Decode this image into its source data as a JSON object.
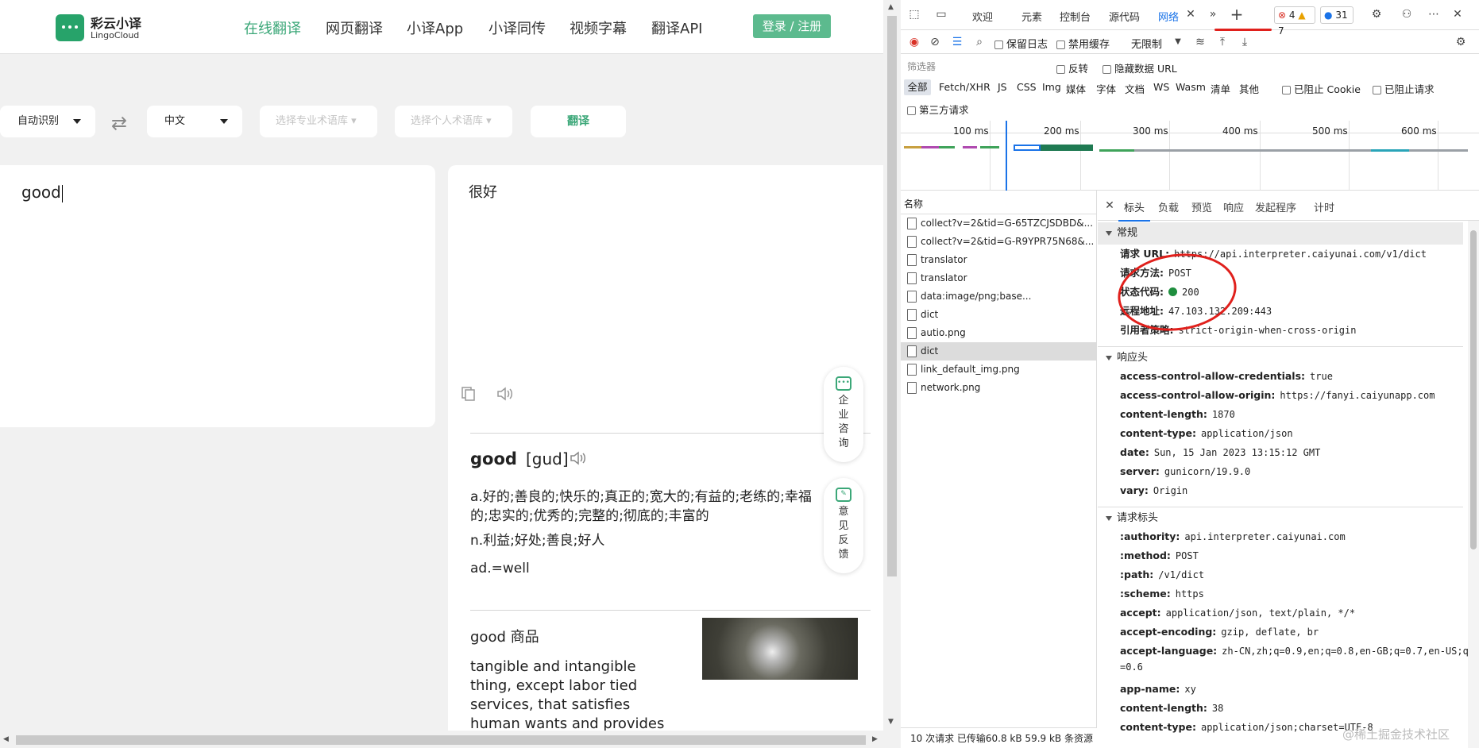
{
  "app": {
    "logo_name": "彩云小译",
    "logo_sub": "LingoCloud",
    "nav": [
      "在线翻译",
      "网页翻译",
      "小译App",
      "小译同传",
      "视频字幕",
      "翻译API"
    ],
    "login": "登录 / 注册",
    "source_lang": "自动识别",
    "target_lang": "中文",
    "term_lib_placeholder": "选择专业术语库 ▾",
    "personal_lib_placeholder": "选择个人术语库 ▾",
    "translate_button": "翻译",
    "swap_icon": "swap-arrows-icon",
    "source_text": "good",
    "result_text": "很好",
    "dict": {
      "word": "good",
      "phonetic": "[gud]",
      "defs": [
        "a.好的;善良的;快乐的;真正的;宽大的;有益的;老练的;幸福的;忠实的;优秀的;完整的;彻底的;丰富的",
        "n.利益;好处;善良;好人",
        "ad.=well"
      ]
    },
    "phrase": {
      "title": "good 商品",
      "desc": "tangible and intangible thing, except labor tied services, that satisfies human wants and provides utility"
    },
    "side_consult": "企业咨询",
    "side_feedback": "意见反馈"
  },
  "devtools": {
    "tabs": [
      "欢迎",
      "元素",
      "控制台",
      "源代码",
      "网络"
    ],
    "errors": "4",
    "warnings": "7",
    "messages": "31",
    "toolbar": {
      "preserve_log": "保留日志",
      "disable_cache": "禁用缓存",
      "throttle": "无限制"
    },
    "filter_placeholder": "筛选器",
    "invert": "反转",
    "hide_data_urls": "隐藏数据 URL",
    "filter_types": [
      "全部",
      "Fetch/XHR",
      "JS",
      "CSS",
      "Img",
      "媒体",
      "字体",
      "文档",
      "WS",
      "Wasm",
      "清单",
      "其他"
    ],
    "blocked_cookies": "已阻止 Cookie",
    "blocked_requests": "已阻止请求",
    "third_party": "第三方请求",
    "timeline_labels": [
      "100 ms",
      "200 ms",
      "300 ms",
      "400 ms",
      "500 ms",
      "600 ms"
    ],
    "name_header": "名称",
    "requests": [
      "collect?v=2&tid=G-65TZCJSDBD&...",
      "collect?v=2&tid=G-R9YPR75N68&...",
      "translator",
      "translator",
      "data:image/png;base...",
      "dict",
      "autio.png",
      "dict",
      "link_default_img.png",
      "network.png"
    ],
    "detail_tabs": [
      "标头",
      "负载",
      "预览",
      "响应",
      "发起程序",
      "计时"
    ],
    "general_title": "常规",
    "general": [
      {
        "k": "请求 URL:",
        "v": "https://api.interpreter.caiyunai.com/v1/dict"
      },
      {
        "k": "请求方法:",
        "v": "POST"
      },
      {
        "k": "状态代码:",
        "v": "200"
      },
      {
        "k": "远程地址:",
        "v": "47.103.132.209:443"
      },
      {
        "k": "引用者策略:",
        "v": "strict-origin-when-cross-origin"
      }
    ],
    "response_title": "响应头",
    "response_headers": [
      {
        "k": "access-control-allow-credentials:",
        "v": "true"
      },
      {
        "k": "access-control-allow-origin:",
        "v": "https://fanyi.caiyunapp.com"
      },
      {
        "k": "content-length:",
        "v": "1870"
      },
      {
        "k": "content-type:",
        "v": "application/json"
      },
      {
        "k": "date:",
        "v": "Sun, 15 Jan 2023 13:15:12 GMT"
      },
      {
        "k": "server:",
        "v": "gunicorn/19.9.0"
      },
      {
        "k": "vary:",
        "v": "Origin"
      }
    ],
    "request_title": "请求标头",
    "request_headers": [
      {
        "k": ":authority:",
        "v": "api.interpreter.caiyunai.com"
      },
      {
        "k": ":method:",
        "v": "POST"
      },
      {
        "k": ":path:",
        "v": "/v1/dict"
      },
      {
        "k": ":scheme:",
        "v": "https"
      },
      {
        "k": "accept:",
        "v": "application/json, text/plain, */*"
      },
      {
        "k": "accept-encoding:",
        "v": "gzip, deflate, br"
      },
      {
        "k": "accept-language:",
        "v": "zh-CN,zh;q=0.9,en;q=0.8,en-GB;q=0.7,en-US;q=0.6"
      },
      {
        "k": "app-name:",
        "v": "xy"
      },
      {
        "k": "content-length:",
        "v": "38"
      },
      {
        "k": "content-type:",
        "v": "application/json;charset=UTF-8"
      }
    ],
    "status_bar": "10 次请求  已传输60.8 kB  59.9 kB 条资源"
  },
  "watermark": "@稀土掘金技术社区",
  "colors": {
    "brand": "#3ba778",
    "annotation": "#e0201c",
    "devtools_accent": "#1a73e8"
  }
}
